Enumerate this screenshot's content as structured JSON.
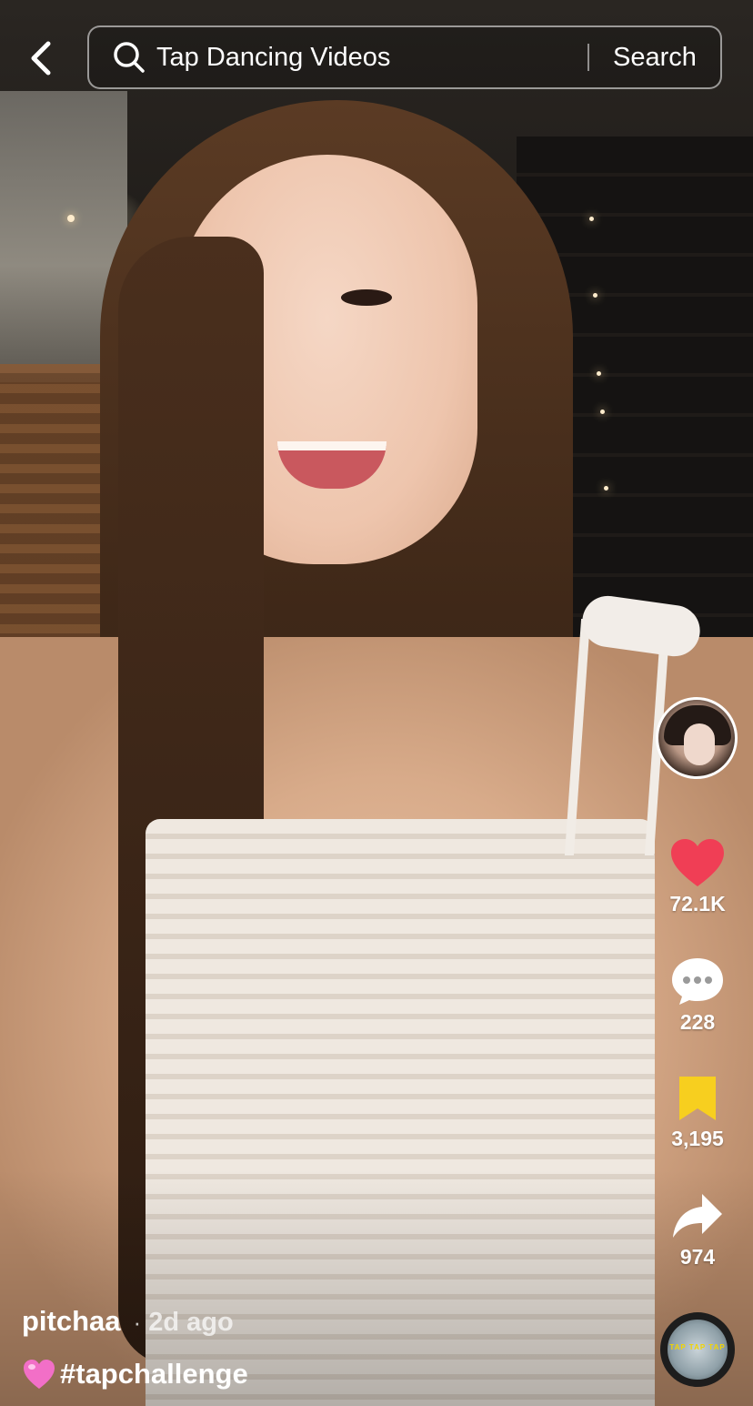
{
  "search": {
    "query": "Tap Dancing Videos",
    "button_label": "Search"
  },
  "actions": {
    "likes": "72.1K",
    "comments": "228",
    "saves": "3,195",
    "shares": "974"
  },
  "video": {
    "author": "pitchaa",
    "separator": "·",
    "posted": "2d ago",
    "caption_hashtag": "#tapchallenge",
    "caption_emoji": "pink-heart-emoji"
  },
  "music": {
    "disc_label": "TAP TAP TAP"
  },
  "colors": {
    "like_red": "#f03e55",
    "save_yellow": "#f7cf1f",
    "caption_heart_pink": "#f26fc7"
  }
}
